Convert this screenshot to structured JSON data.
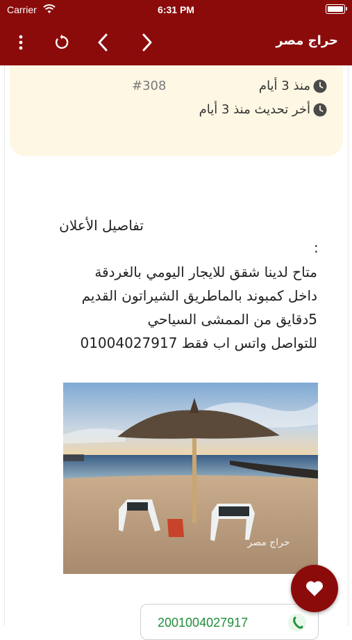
{
  "status_bar": {
    "carrier": "Carrier",
    "time": "6:31 PM"
  },
  "toolbar": {
    "title": "حراج مصر"
  },
  "ad_info": {
    "posted": "منذ 3 أيام",
    "updated": "أخر تحديث منذ 3 أيام",
    "number": "#308"
  },
  "details": {
    "title": "تفاصيل الأعلان",
    "colon": ":",
    "lines": [
      "متاح لدينا شقق للايجار اليومي  بالغردقة",
      "داخل كمبوند  بالماطريق الشيراتون القديم",
      "5دقايق من الممشى السياحي",
      "للتواصل واتس اب فقط 01004027917"
    ]
  },
  "image": {
    "watermark": "حراج مصر"
  },
  "contact": {
    "phone": "2001004027917"
  },
  "colors": {
    "brand": "#8b0b0b",
    "card": "#fdf7e3",
    "whatsapp": "#1f8f3a"
  },
  "icons": [
    "wifi-icon",
    "battery-icon",
    "more-vertical-icon",
    "reload-icon",
    "chevron-left-icon",
    "chevron-right-icon",
    "clock-icon",
    "whatsapp-icon",
    "heart-icon"
  ]
}
